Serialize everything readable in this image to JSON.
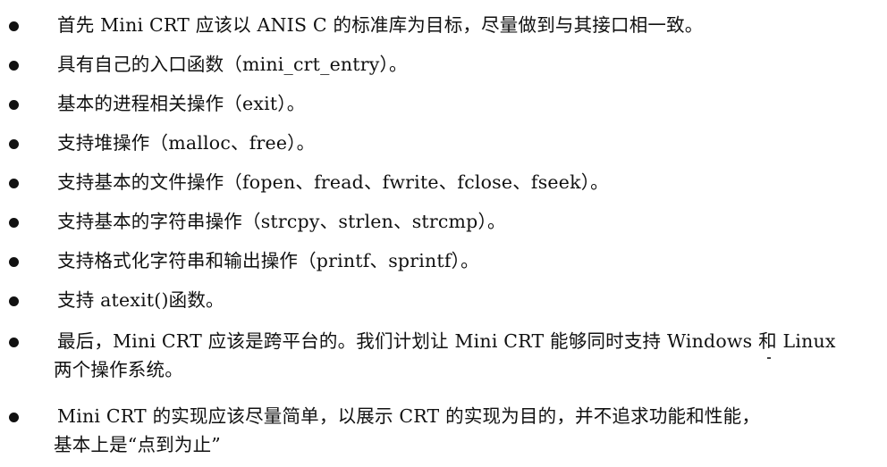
{
  "items": [
    {
      "text": "首先 Mini CRT 应该以 ANIS C 的标准库为目标，尽量做到与其接口相一致。"
    },
    {
      "text": "具有自己的入口函数（mini_crt_entry）。"
    },
    {
      "text": "基本的进程相关操作（exit）。"
    },
    {
      "text": "支持堆操作（malloc、free）。"
    },
    {
      "text": "支持基本的文件操作（fopen、fread、fwrite、fclose、fseek）。"
    },
    {
      "text": "支持基本的字符串操作（strcpy、strlen、strcmp）。"
    },
    {
      "text": "支持格式化字符串和输出操作（printf、sprintf）。"
    },
    {
      "text": "支持 atexit()函数。"
    },
    {
      "text": "最后，Mini CRT 应该是跨平台的。我们计划让 Mini CRT 能够同时支持 Windows 和 Linux",
      "continuation": "两个操作系统。"
    },
    {
      "text": "Mini CRT 的实现应该尽量简单，以展示 CRT 的实现为目的，并不追求功能和性能，",
      "continuation": "基本上是“点到为止”"
    }
  ]
}
